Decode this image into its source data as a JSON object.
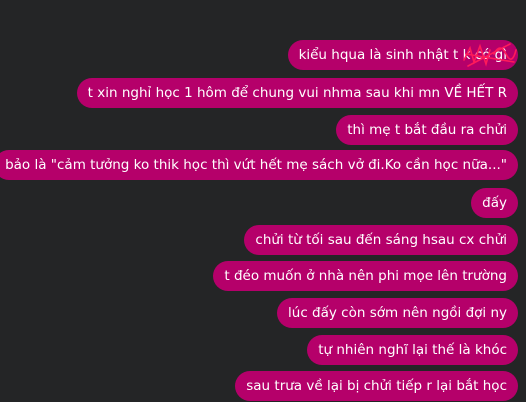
{
  "messages": [
    {
      "text": "kiểu hqua là sinh nhật t k có gì"
    },
    {
      "text": "t xin nghỉ học 1 hôm để chung vui nhma sau khi mn VỀ HẾT R"
    },
    {
      "text": "thì mẹ t bắt đầu ra chửi"
    },
    {
      "text": "bảo là \"cảm tưởng ko thik học thì vứt hết mẹ sách vở đi.Ko cần học nữa...\""
    },
    {
      "text": "đấy"
    },
    {
      "text": "chửi từ tối sau đến sáng hsau cx chửi"
    },
    {
      "text": "t đéo muốn ở nhà nên phi mọe lên trường"
    },
    {
      "text": "lúc đấy còn sớm nên ngồi đợi ny"
    },
    {
      "text": "tự nhiên nghĩ lại thế là khóc"
    },
    {
      "text": "sau trưa về lại bị chửi tiếp r lại bắt học"
    }
  ],
  "colors": {
    "background": "#242526",
    "bubble": "#b5006a",
    "text": "#ffffff",
    "scribble": "#ff1a5a"
  }
}
